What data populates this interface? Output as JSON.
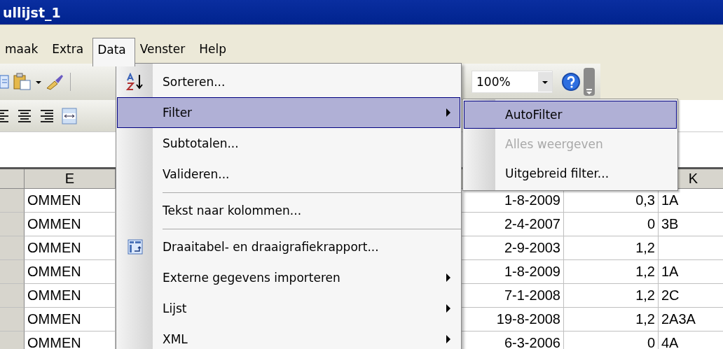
{
  "window": {
    "title": "ullijst_1"
  },
  "menubar": [
    {
      "label": "maak",
      "selected": false
    },
    {
      "label": "Extra",
      "selected": false
    },
    {
      "label": "Data",
      "selected": true
    },
    {
      "label": "Venster",
      "selected": false
    },
    {
      "label": "Help",
      "selected": false
    }
  ],
  "toolbar": {
    "zoom": "100%"
  },
  "data_menu": [
    {
      "kind": "sort",
      "label": "Sorteren...",
      "submenu": false,
      "selected": false
    },
    {
      "kind": "item",
      "label": "Filter",
      "submenu": true,
      "selected": true
    },
    {
      "kind": "item",
      "label": "Subtotalen...",
      "submenu": false,
      "selected": false
    },
    {
      "kind": "item",
      "label": "Valideren...",
      "submenu": false,
      "selected": false
    },
    {
      "kind": "separator"
    },
    {
      "kind": "item",
      "label": "Tekst naar kolommen...",
      "submenu": false,
      "selected": false
    },
    {
      "kind": "separator"
    },
    {
      "kind": "pivot",
      "label": "Draaitabel- en draaigrafiekrapport...",
      "submenu": false,
      "selected": false
    },
    {
      "kind": "item",
      "label": "Externe gegevens importeren",
      "submenu": true,
      "selected": false
    },
    {
      "kind": "item",
      "label": "Lijst",
      "submenu": true,
      "selected": false
    },
    {
      "kind": "item",
      "label": "XML",
      "submenu": true,
      "selected": false
    }
  ],
  "filter_submenu": [
    {
      "label": "AutoFilter",
      "selected": true,
      "disabled": false
    },
    {
      "label": "Alles weergeven",
      "selected": false,
      "disabled": true
    },
    {
      "label": "Uitgebreid filter...",
      "selected": false,
      "disabled": false
    }
  ],
  "sheet": {
    "columns": [
      "E",
      "K"
    ],
    "rows": [
      {
        "column_e": "OMMEN",
        "date": "1-8-2009",
        "value": "0,3",
        "code": "1A"
      },
      {
        "column_e": "OMMEN",
        "date": "2-4-2007",
        "value": "0",
        "code": "3B"
      },
      {
        "column_e": "OMMEN",
        "date": "2-9-2003",
        "value": "1,2"
      },
      {
        "column_e": "OMMEN",
        "date": "1-8-2009",
        "value": "1,2",
        "code": "1A"
      },
      {
        "column_e": "OMMEN",
        "date": "7-1-2008",
        "value": "1,2",
        "code": "2C"
      },
      {
        "column_e": "OMMEN",
        "date": "19-8-2008",
        "value": "1,2",
        "code": "2A3A"
      },
      {
        "column_e": "OMMEN",
        "date": "6-3-2006",
        "value": "0",
        "code": "4A"
      }
    ]
  }
}
